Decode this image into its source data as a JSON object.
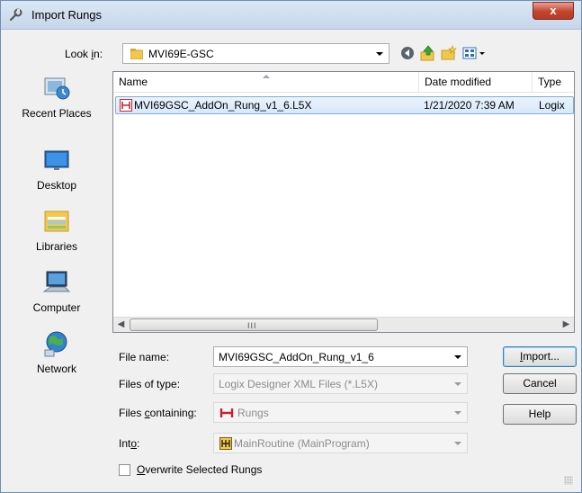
{
  "window": {
    "title": "Import Rungs",
    "close_symbol": "x"
  },
  "lookin": {
    "label_before": "Look ",
    "label_mnemonic": "i",
    "label_after": "n:",
    "value": "MVI69E-GSC"
  },
  "toolbar": {
    "icons": [
      "back-icon",
      "up-folder-icon",
      "new-folder-icon",
      "view-menu-icon"
    ]
  },
  "places": [
    {
      "label": "Recent Places",
      "icon": "recent-places-icon"
    },
    {
      "label": "Desktop",
      "icon": "desktop-icon"
    },
    {
      "label": "Libraries",
      "icon": "libraries-icon"
    },
    {
      "label": "Computer",
      "icon": "computer-icon"
    },
    {
      "label": "Network",
      "icon": "network-icon"
    }
  ],
  "filelist": {
    "columns": [
      "Name",
      "Date modified",
      "Type"
    ],
    "files": [
      {
        "name": "MVI69GSC_AddOn_Rung_v1_6.L5X",
        "date": "1/21/2020 7:39 AM",
        "type": "Logix"
      }
    ],
    "scroll_grip": "III"
  },
  "form": {
    "file_name_label": "File name:",
    "file_name_value": "MVI69GSC_AddOn_Rung_v1_6",
    "files_of_type_label": "Files of type:",
    "files_of_type_value": "Logix Designer XML Files (*.L5X)",
    "files_containing_label_a": "Files ",
    "files_containing_label_m": "c",
    "files_containing_label_b": "ontaining:",
    "files_containing_value": "Rungs",
    "into_label_a": "Int",
    "into_label_m": "o",
    "into_label_b": ":",
    "into_value": "MainRoutine (MainProgram)",
    "overwrite_label_m": "O",
    "overwrite_label_b": "verwrite Selected Rungs",
    "overwrite_checked": false
  },
  "buttons": {
    "import_m": "I",
    "import_rest": "mport...",
    "cancel": "Cancel",
    "help": "Help"
  },
  "colors": {
    "selection": "#d7e8fb",
    "rung_icon": "#c0262d"
  }
}
